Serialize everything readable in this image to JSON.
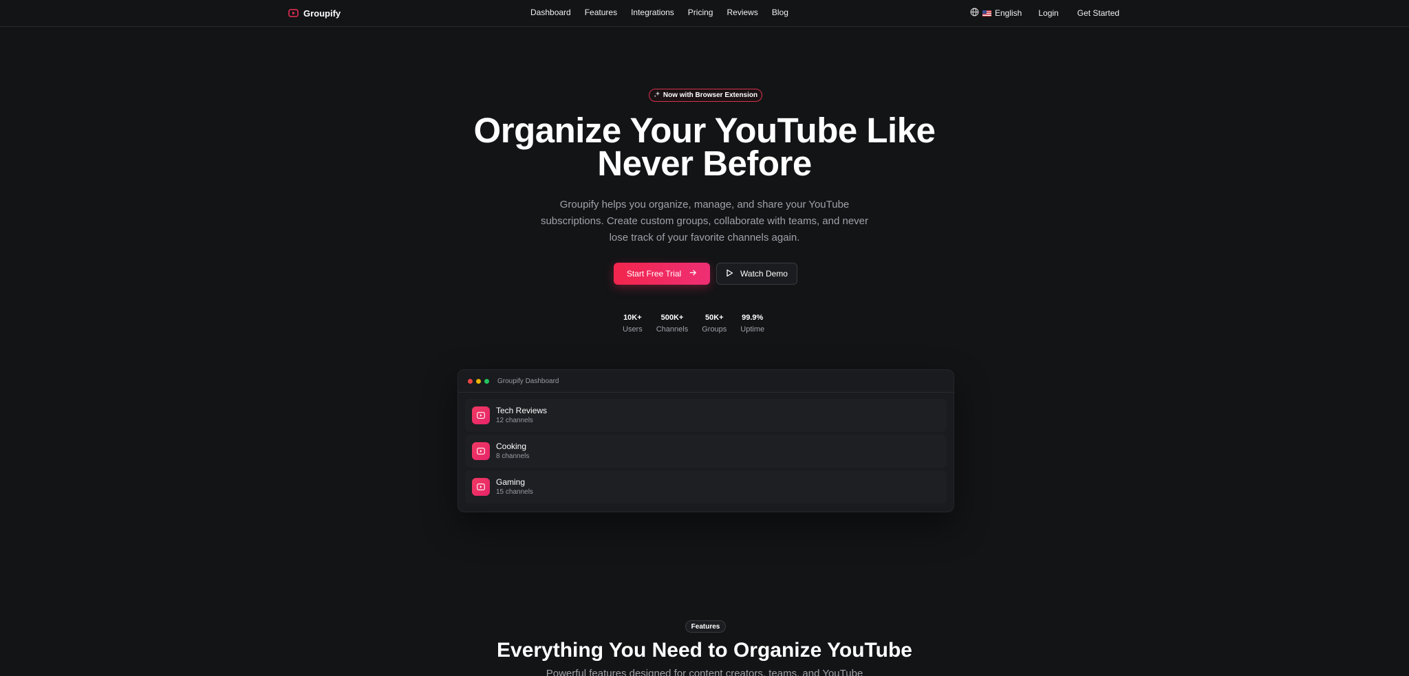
{
  "brand": {
    "name": "Groupify",
    "accent": "#f0284f"
  },
  "nav": {
    "links": [
      "Dashboard",
      "Features",
      "Integrations",
      "Pricing",
      "Reviews",
      "Blog"
    ],
    "language": "English",
    "login": "Login",
    "cta": "Get Started"
  },
  "hero": {
    "badge": "Now with Browser Extension",
    "title_line1": "Organize Your YouTube Like",
    "title_line2": "Never Before",
    "subtitle": "Groupify helps you organize, manage, and share your YouTube subscriptions. Create custom groups, collaborate with teams, and never lose track of your favorite channels again.",
    "primary_button": "Start Free Trial",
    "secondary_button": "Watch Demo"
  },
  "stats": [
    {
      "value": "10K+",
      "label": "Users"
    },
    {
      "value": "500K+",
      "label": "Channels"
    },
    {
      "value": "50K+",
      "label": "Groups"
    },
    {
      "value": "99.9%",
      "label": "Uptime"
    }
  ],
  "dashboard": {
    "title": "Groupify Dashboard",
    "window_dot_colors": [
      "#ef4444",
      "#eab308",
      "#22c55e"
    ],
    "groups": [
      {
        "name": "Tech Reviews",
        "count": "12 channels"
      },
      {
        "name": "Cooking",
        "count": "8 channels"
      },
      {
        "name": "Gaming",
        "count": "15 channels"
      }
    ]
  },
  "features": {
    "badge": "Features",
    "title": "Everything You Need to Organize YouTube",
    "subtitle": "Powerful features designed for content creators, teams, and YouTube"
  }
}
